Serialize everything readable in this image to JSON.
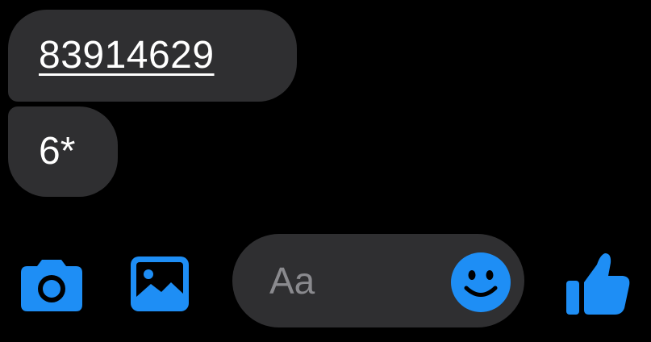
{
  "messages": [
    {
      "text": "83914629",
      "link": true
    },
    {
      "text": "6*",
      "link": false
    }
  ],
  "composer": {
    "placeholder": "Aa"
  },
  "toolbar": {
    "camera_icon": "camera-icon",
    "gallery_icon": "image-gallery-icon",
    "emoji_icon": "smiley-emoji-icon",
    "like_icon": "thumbs-up-icon"
  },
  "colors": {
    "background": "#000000",
    "bubble": "#2f2f31",
    "accent": "#1e8ef5",
    "placeholder": "#8a8a8e",
    "text": "#ffffff"
  }
}
